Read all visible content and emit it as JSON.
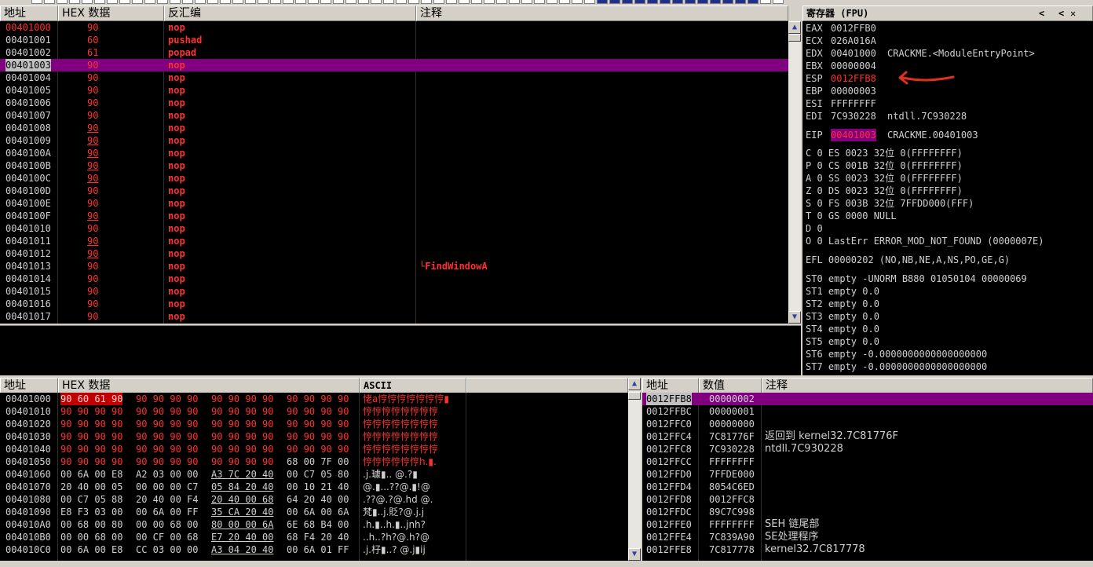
{
  "disasm": {
    "headers": {
      "addr": "地址",
      "hex": "HEX 数据",
      "dis": "反汇编",
      "comment": "注释"
    },
    "rows": [
      {
        "addr": "00401000",
        "hex": "90",
        "dis": "nop",
        "comment": ""
      },
      {
        "addr": "00401001",
        "hex": "60",
        "dis": "pushad",
        "comment": ""
      },
      {
        "addr": "00401002",
        "hex": "61",
        "dis": "popad",
        "comment": ""
      },
      {
        "addr": "00401003",
        "hex": "90",
        "dis": "nop",
        "comment": ""
      },
      {
        "addr": "00401004",
        "hex": "90",
        "dis": "nop",
        "comment": ""
      },
      {
        "addr": "00401005",
        "hex": "90",
        "dis": "nop",
        "comment": ""
      },
      {
        "addr": "00401006",
        "hex": "90",
        "dis": "nop",
        "comment": ""
      },
      {
        "addr": "00401007",
        "hex": "90",
        "dis": "nop",
        "comment": ""
      },
      {
        "addr": "00401008",
        "hex": "90",
        "dis": "nop",
        "comment": ""
      },
      {
        "addr": "00401009",
        "hex": "90",
        "dis": "nop",
        "comment": ""
      },
      {
        "addr": "0040100A",
        "hex": "90",
        "dis": "nop",
        "comment": ""
      },
      {
        "addr": "0040100B",
        "hex": "90",
        "dis": "nop",
        "comment": ""
      },
      {
        "addr": "0040100C",
        "hex": "90",
        "dis": "nop",
        "comment": ""
      },
      {
        "addr": "0040100D",
        "hex": "90",
        "dis": "nop",
        "comment": ""
      },
      {
        "addr": "0040100E",
        "hex": "90",
        "dis": "nop",
        "comment": ""
      },
      {
        "addr": "0040100F",
        "hex": "90",
        "dis": "nop",
        "comment": ""
      },
      {
        "addr": "00401010",
        "hex": "90",
        "dis": "nop",
        "comment": ""
      },
      {
        "addr": "00401011",
        "hex": "90",
        "dis": "nop",
        "comment": ""
      },
      {
        "addr": "00401012",
        "hex": "90",
        "dis": "nop",
        "comment": ""
      },
      {
        "addr": "00401013",
        "hex": "90",
        "dis": "nop",
        "comment": "└FindWindowA"
      },
      {
        "addr": "00401014",
        "hex": "90",
        "dis": "nop",
        "comment": ""
      },
      {
        "addr": "00401015",
        "hex": "90",
        "dis": "nop",
        "comment": ""
      },
      {
        "addr": "00401016",
        "hex": "90",
        "dis": "nop",
        "comment": ""
      },
      {
        "addr": "00401017",
        "hex": "90",
        "dis": "nop",
        "comment": ""
      }
    ]
  },
  "registers": {
    "title": "寄存器 (FPU)",
    "nav_left": "<",
    "nav_right": "<",
    "gp": [
      {
        "name": "EAX",
        "value": "0012FFB0",
        "extra": ""
      },
      {
        "name": "ECX",
        "value": "026A016A",
        "extra": ""
      },
      {
        "name": "EDX",
        "value": "00401000",
        "extra": "CRACKME.<ModuleEntryPoint>"
      },
      {
        "name": "EBX",
        "value": "00000004",
        "extra": ""
      },
      {
        "name": "ESP",
        "value": "0012FFB8",
        "extra": ""
      },
      {
        "name": "EBP",
        "value": "00000003",
        "extra": ""
      },
      {
        "name": "ESI",
        "value": "FFFFFFFF",
        "extra": ""
      },
      {
        "name": "EDI",
        "value": "7C930228",
        "extra": "ntdll.7C930228"
      }
    ],
    "eip": {
      "name": "EIP",
      "value": "00401003",
      "extra": "CRACKME.00401003"
    },
    "flags": [
      "C 0  ES 0023 32位 0(FFFFFFFF)",
      "P 0  CS 001B 32位 0(FFFFFFFF)",
      "A 0  SS 0023 32位 0(FFFFFFFF)",
      "Z 0  DS 0023 32位 0(FFFFFFFF)",
      "S 0  FS 003B 32位 7FFDD000(FFF)",
      "T 0  GS 0000 NULL",
      "D 0",
      "O 0  LastErr ERROR_MOD_NOT_FOUND (0000007E)"
    ],
    "efl": "EFL 00000202 (NO,NB,NE,A,NS,PO,GE,G)",
    "fpu": [
      "ST0 empty -UNORM B880 01050104 00000069",
      "ST1 empty 0.0",
      "ST2 empty 0.0",
      "ST3 empty 0.0",
      "ST4 empty 0.0",
      "ST5 empty 0.0",
      "ST6 empty -0.0000000000000000000",
      "ST7 empty -0.0000000000000000000"
    ],
    "arrow_color": "#e03020"
  },
  "dump": {
    "headers": {
      "addr": "地址",
      "hex": "HEX 数据",
      "ascii": "ASCII"
    },
    "rows": [
      {
        "addr": "00401000",
        "g": [
          "90 60 61 90",
          "90 90 90 90",
          "90 90 90 90",
          "90 90 90 90"
        ],
        "ascii": "恅a悙悙悙悙悙悙悙▮"
      },
      {
        "addr": "00401010",
        "g": [
          "90 90 90 90",
          "90 90 90 90",
          "90 90 90 90",
          "90 90 90 90"
        ],
        "ascii": "悙悙悙悙悙悙悙悙"
      },
      {
        "addr": "00401020",
        "g": [
          "90 90 90 90",
          "90 90 90 90",
          "90 90 90 90",
          "90 90 90 90"
        ],
        "ascii": "悙悙悙悙悙悙悙悙"
      },
      {
        "addr": "00401030",
        "g": [
          "90 90 90 90",
          "90 90 90 90",
          "90 90 90 90",
          "90 90 90 90"
        ],
        "ascii": "悙悙悙悙悙悙悙悙"
      },
      {
        "addr": "00401040",
        "g": [
          "90 90 90 90",
          "90 90 90 90",
          "90 90 90 90",
          "90 90 90 90"
        ],
        "ascii": "悙悙悙悙悙悙悙悙"
      },
      {
        "addr": "00401050",
        "g": [
          "90 90 90 90",
          "90 90 90 90",
          "90 90 90 90",
          "68 00 7F 00"
        ],
        "ascii": "悙悙悙悙悙悙h.▮."
      },
      {
        "addr": "00401060",
        "g": [
          "00 6A 00 E8",
          "A2 03 00 00",
          "A3 7C 20 40",
          "00 C7 05 80"
        ],
        "ascii": ".j.璩▮..   @.?▮"
      },
      {
        "addr": "00401070",
        "g": [
          "20 40 00 05",
          "00 00 00 C7",
          "05 84 20 40",
          "00 10 21 40"
        ],
        "ascii": " @.▮...??@.▮!@"
      },
      {
        "addr": "00401080",
        "g": [
          "00 C7 05 88",
          "20 40 00 F4",
          "20 40 00 68",
          "64 20 40 00"
        ],
        "ascii": ".??@.?@.hd @."
      },
      {
        "addr": "00401090",
        "g": [
          "E8 F3 03 00",
          "00 6A 00 FF",
          "35 CA 20 40",
          "00 6A 00 6A"
        ],
        "ascii": "梵▮..j.貶?@.j.j"
      },
      {
        "addr": "004010A0",
        "g": [
          "00 68 00 80",
          "00 00 68 00",
          "80 00 00 6A",
          "6E 68 B4 00"
        ],
        "ascii": ".h.▮..h.▮..jnh?"
      },
      {
        "addr": "004010B0",
        "g": [
          "00 00 68 00",
          "00 CF 00 68",
          "E7 20 40 00",
          "68 F4 20 40"
        ],
        "ascii": "..h..?h?@.h?@"
      },
      {
        "addr": "004010C0",
        "g": [
          "00 6A 00 E8",
          "CC 03 00 00",
          "A3 04 20 40",
          "00 6A 01 FF"
        ],
        "ascii": ".j.杍▮..? @.j▮ij"
      }
    ]
  },
  "stack": {
    "headers": {
      "addr": "地址",
      "val": "数值",
      "comment": "注释"
    },
    "rows": [
      {
        "addr": "0012FFB8",
        "val": "00000002",
        "comment": ""
      },
      {
        "addr": "0012FFBC",
        "val": "00000001",
        "comment": ""
      },
      {
        "addr": "0012FFC0",
        "val": "00000000",
        "comment": ""
      },
      {
        "addr": "0012FFC4",
        "val": "7C81776F",
        "comment": "返回到 kernel32.7C81776F"
      },
      {
        "addr": "0012FFC8",
        "val": "7C930228",
        "comment": "ntdll.7C930228"
      },
      {
        "addr": "0012FFCC",
        "val": "FFFFFFFF",
        "comment": ""
      },
      {
        "addr": "0012FFD0",
        "val": "7FFDE000",
        "comment": ""
      },
      {
        "addr": "0012FFD4",
        "val": "8054C6ED",
        "comment": ""
      },
      {
        "addr": "0012FFD8",
        "val": "0012FFC8",
        "comment": ""
      },
      {
        "addr": "0012FFDC",
        "val": "89C7C998",
        "comment": ""
      },
      {
        "addr": "0012FFE0",
        "val": "FFFFFFFF",
        "comment": "SEH 链尾部"
      },
      {
        "addr": "0012FFE4",
        "val": "7C839A90",
        "comment": "SE处理程序"
      },
      {
        "addr": "0012FFE8",
        "val": "7C817778",
        "comment": "kernel32.7C817778"
      }
    ]
  },
  "colors": {
    "highlight": "#800080",
    "red": "#ff3030",
    "bg": "#000000",
    "panel": "#d4d0c8"
  }
}
